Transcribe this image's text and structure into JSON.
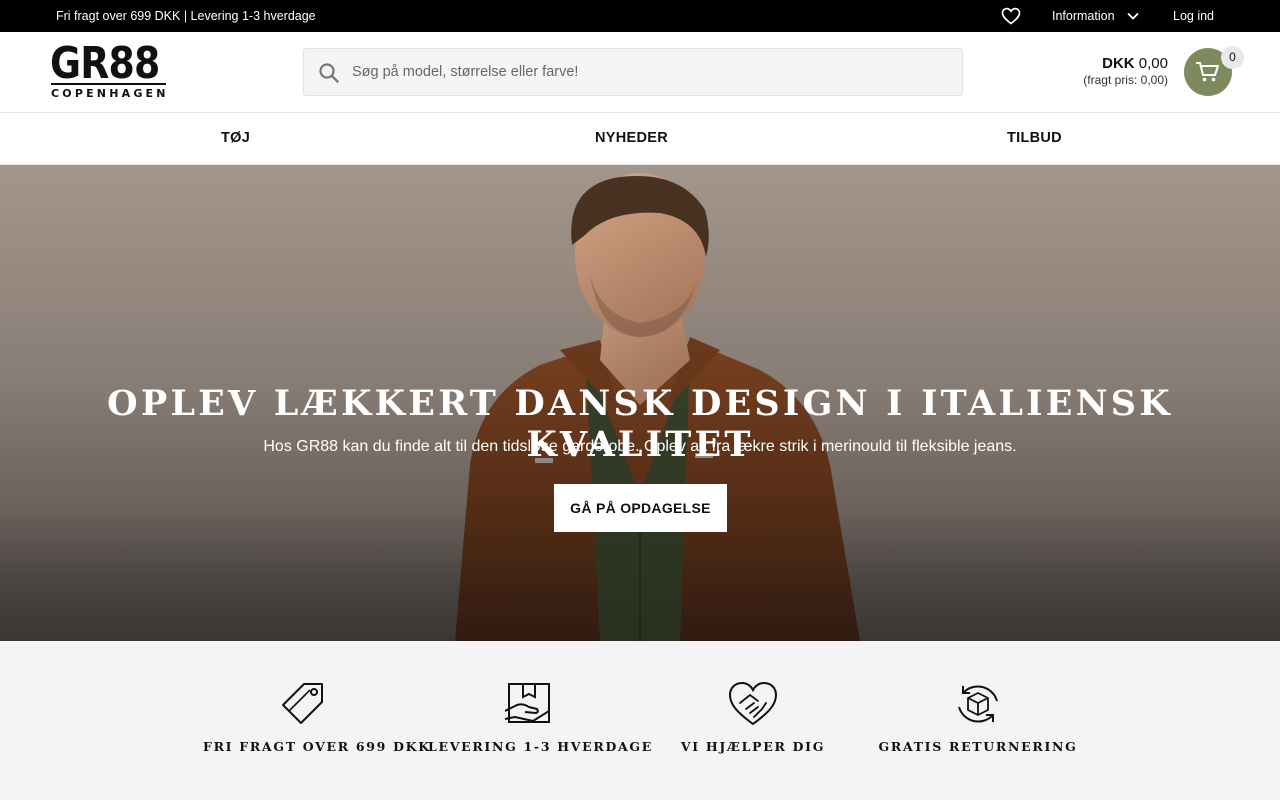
{
  "topbar": {
    "promo": "Fri fragt over 699 DKK | Levering 1-3 hverdage",
    "wishlist_icon": "heart-icon",
    "information_label": "Information",
    "login_label": "Log ind"
  },
  "header": {
    "logo": {
      "main": "GR88",
      "sub": "COPENHAGEN"
    },
    "search": {
      "placeholder": "Søg på model, størrelse eller farve!",
      "value": ""
    },
    "cart": {
      "currency": "DKK",
      "amount": "0,00",
      "shipping": "(fragt pris: 0,00)",
      "count": "0",
      "accent": "#7e8a5e"
    }
  },
  "nav": {
    "items": [
      {
        "label": "TØJ"
      },
      {
        "label": "NYHEDER"
      },
      {
        "label": "TILBUD"
      }
    ]
  },
  "hero": {
    "title": "OPLEV LÆKKERT DANSK DESIGN I ITALIENSK KVALITET",
    "subtitle": "Hos GR88 kan du finde alt til den tidsløse garderobe. Oplev alt fra lækre strik i merinould til fleksible jeans.",
    "cta": "GÅ PÅ OPDAGELSE"
  },
  "usps": [
    {
      "icon": "price-tag-icon",
      "label": "FRI FRAGT OVER 699 DKK"
    },
    {
      "icon": "package-delivery-icon",
      "label": "LEVERING 1-3 HVERDAGE"
    },
    {
      "icon": "handshake-heart-icon",
      "label": "VI HJÆLPER DIG"
    },
    {
      "icon": "return-box-icon",
      "label": "GRATIS RETURNERING"
    }
  ],
  "colors": {
    "topbar": "#000000",
    "usp_bg": "#f4f4f4",
    "cart_accent": "#7e8a5e"
  }
}
